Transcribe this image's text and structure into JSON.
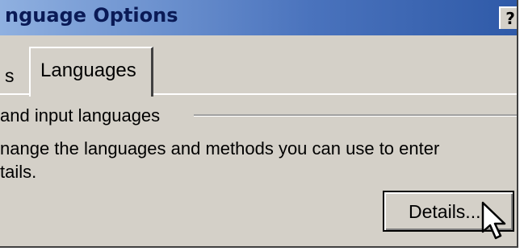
{
  "window": {
    "title": "nguage Options",
    "help_label": "?"
  },
  "tabs": [
    {
      "label": "s"
    },
    {
      "label": "Languages"
    }
  ],
  "group": {
    "label": "and input languages",
    "description_line1": "nange the languages and methods you can use to enter",
    "description_line2": "tails."
  },
  "buttons": {
    "details_label": "Details..."
  },
  "cursor": {
    "icon": "arrow-pointer-icon"
  }
}
